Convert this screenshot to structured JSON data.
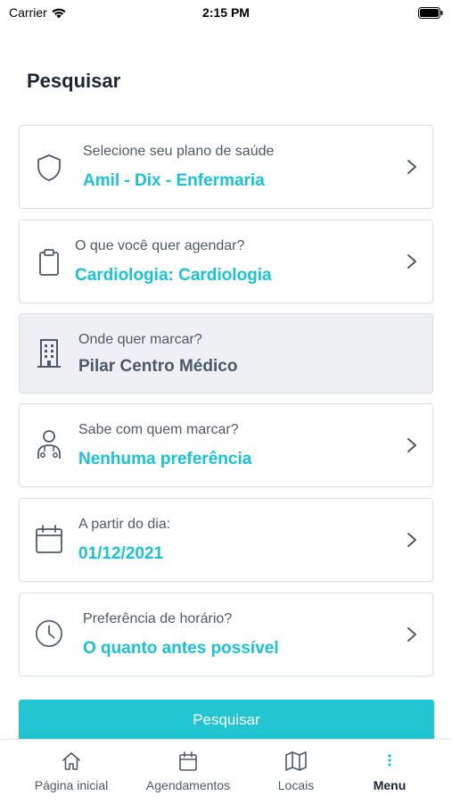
{
  "status_bar": {
    "carrier": "Carrier",
    "time": "2:15 PM"
  },
  "page": {
    "title": "Pesquisar"
  },
  "cards": [
    {
      "icon": "shield-icon",
      "label": "Selecione seu plano de saúde",
      "value": "Amil - Dix - Enfermaria",
      "enabled": true
    },
    {
      "icon": "clipboard-icon",
      "label": "O que você quer agendar?",
      "value": "Cardiologia: Cardiologia",
      "enabled": true
    },
    {
      "icon": "building-icon",
      "label": "Onde quer marcar?",
      "value": "Pilar Centro Médico",
      "enabled": false
    },
    {
      "icon": "doctor-icon",
      "label": "Sabe com quem marcar?",
      "value": "Nenhuma preferência",
      "enabled": true
    },
    {
      "icon": "calendar-icon",
      "label": "A partir do dia:",
      "value": "01/12/2021",
      "enabled": true
    },
    {
      "icon": "clock-icon",
      "label": "Preferência de horário?",
      "value": "O quanto antes possível",
      "enabled": true
    }
  ],
  "search_button": {
    "label": "Pesquisar"
  },
  "tabbar": {
    "items": [
      {
        "icon": "home-icon",
        "label": "Página inicial",
        "active": false
      },
      {
        "icon": "calendar-icon",
        "label": "Agendamentos",
        "active": false
      },
      {
        "icon": "map-icon",
        "label": "Locais",
        "active": false
      },
      {
        "icon": "more-vertical-icon",
        "label": "Menu",
        "active": true
      }
    ]
  },
  "colors": {
    "accent": "#18c3d6",
    "button": "#21c6d2",
    "text_dark": "#1c2733",
    "text_muted": "#4f5a66",
    "disabled_bg": "#eef0f3"
  }
}
